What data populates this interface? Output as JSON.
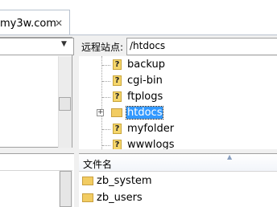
{
  "tab": {
    "title": "my3w.com",
    "close_glyph": "✕"
  },
  "local": {
    "dropdown_glyph": "▼"
  },
  "remote": {
    "site_label": "远程站点:",
    "site_path": "/htdocs",
    "tree": [
      {
        "name": "backup",
        "icon": "question-folder-icon",
        "selected": false
      },
      {
        "name": "cgi-bin",
        "icon": "question-folder-icon",
        "selected": false
      },
      {
        "name": "ftplogs",
        "icon": "question-folder-icon",
        "selected": false
      },
      {
        "name": "htdocs",
        "icon": "folder-icon",
        "selected": true,
        "expander": "+"
      },
      {
        "name": "myfolder",
        "icon": "question-folder-icon",
        "selected": false
      },
      {
        "name": "wwwlogs",
        "icon": "question-folder-icon",
        "selected": false
      }
    ],
    "list_header": "文件名",
    "files": [
      {
        "name": "zb_system",
        "icon": "folder-icon"
      },
      {
        "name": "zb_users",
        "icon": "folder-icon"
      }
    ]
  },
  "colors": {
    "selection": "#3399ff",
    "folder": "#f2cc62"
  }
}
